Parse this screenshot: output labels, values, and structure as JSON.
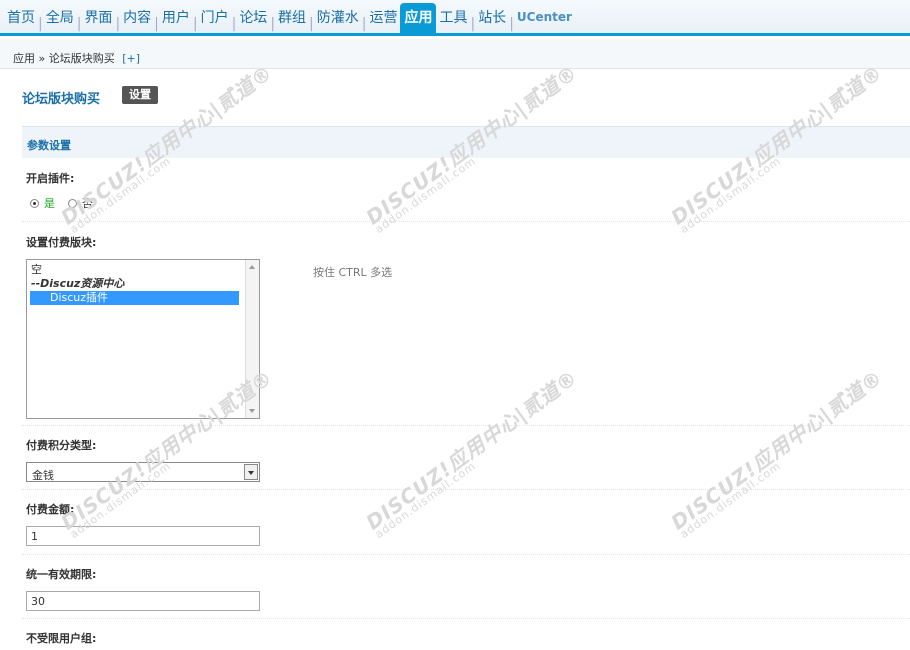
{
  "nav": {
    "items": [
      "首页",
      "全局",
      "界面",
      "内容",
      "用户",
      "门户",
      "论坛",
      "群组",
      "防灌水",
      "运营",
      "应用",
      "工具",
      "站长",
      "UCenter"
    ],
    "active_index": 10
  },
  "breadcrumb": {
    "text": "应用 » 论坛版块购买",
    "plus": "[+]"
  },
  "page": {
    "title": "论坛版块购买",
    "settings_button": "设置"
  },
  "section": {
    "title": "参数设置"
  },
  "fields": {
    "enable_plugin": {
      "label": "开启插件:",
      "yes": "是",
      "no": "否",
      "selected": "yes"
    },
    "paid_forum": {
      "label": "设置付费版块:",
      "options": [
        {
          "text": "空",
          "type": "option"
        },
        {
          "text": "--Discuz资源中心",
          "type": "group"
        },
        {
          "text": "Discuz插件",
          "type": "option",
          "selected": true
        }
      ],
      "hint": "按住 CTRL 多选"
    },
    "credit_type": {
      "label": "付费积分类型:",
      "value": "金钱"
    },
    "amount": {
      "label": "付费金额:",
      "value": "1"
    },
    "validity": {
      "label": "统一有效期限:",
      "value": "30"
    },
    "exempt_groups": {
      "label": "不受限用户组:"
    }
  },
  "watermark": {
    "line1": "DISCUZ!应用中心|贰道®",
    "line2": "addon.dismall.com"
  }
}
